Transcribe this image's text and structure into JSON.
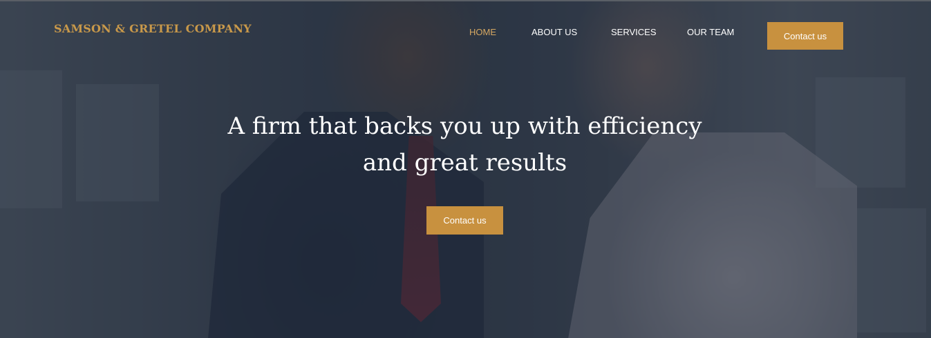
{
  "brand": {
    "name": "SAMSON & GRETEL COMPANY"
  },
  "nav": {
    "items": [
      {
        "label": "HOME",
        "active": true
      },
      {
        "label": "ABOUT US",
        "active": false
      },
      {
        "label": "SERVICES",
        "active": false
      },
      {
        "label": "OUR TEAM",
        "active": false
      }
    ],
    "cta_label": "Contact us"
  },
  "hero": {
    "headline_line1": "A firm that backs you up with efficiency",
    "headline_line2": "and great results",
    "cta_label": "Contact us"
  },
  "colors": {
    "accent": "#c8913f",
    "brand_text": "#c9994a",
    "active_nav": "#d6a862",
    "overlay": "#242d3c"
  }
}
